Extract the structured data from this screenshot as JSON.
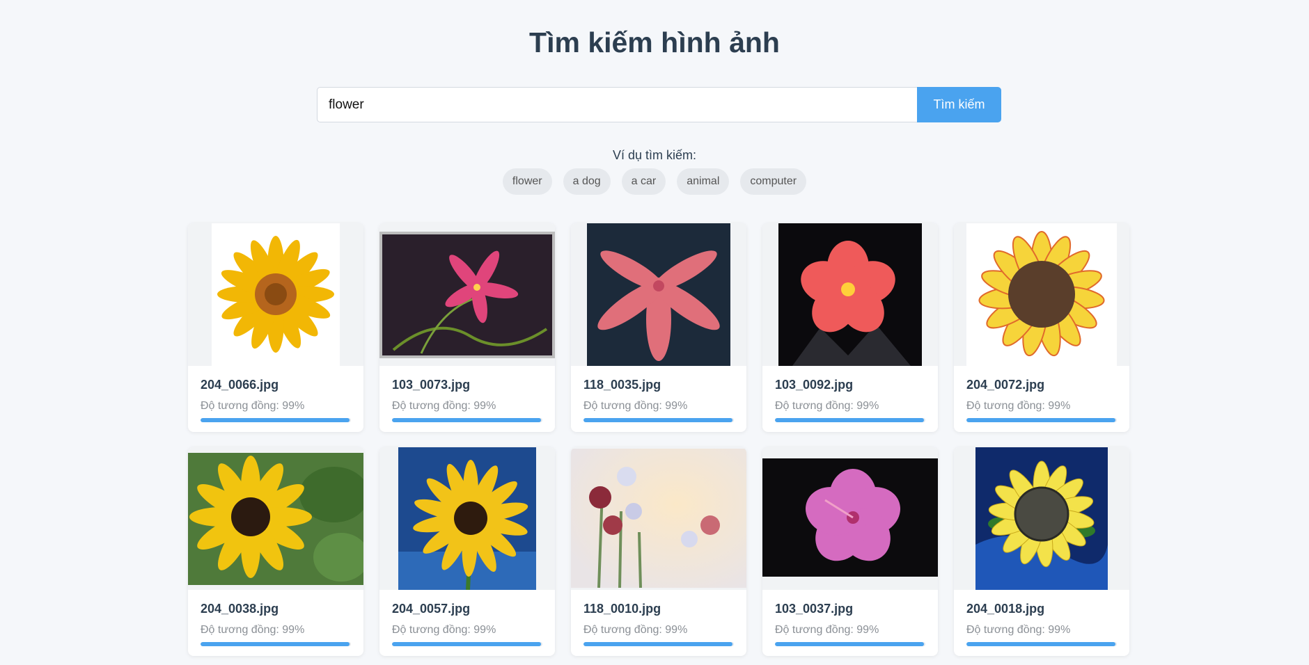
{
  "page": {
    "title": "Tìm kiếm hình ảnh"
  },
  "search": {
    "value": "flower",
    "button_label": "Tìm kiếm"
  },
  "examples": {
    "label": "Ví dụ tìm kiếm:",
    "chips": [
      "flower",
      "a dog",
      "a car",
      "animal",
      "computer"
    ]
  },
  "results": [
    {
      "file": "204_0066.jpg",
      "similarity_label": "Độ tương đồng: 99%",
      "similarity": 0.99
    },
    {
      "file": "103_0073.jpg",
      "similarity_label": "Độ tương đồng: 99%",
      "similarity": 0.99
    },
    {
      "file": "118_0035.jpg",
      "similarity_label": "Độ tương đồng: 99%",
      "similarity": 0.99
    },
    {
      "file": "103_0092.jpg",
      "similarity_label": "Độ tương đồng: 99%",
      "similarity": 0.99
    },
    {
      "file": "204_0072.jpg",
      "similarity_label": "Độ tương đồng: 99%",
      "similarity": 0.99
    },
    {
      "file": "204_0038.jpg",
      "similarity_label": "Độ tương đồng: 99%",
      "similarity": 0.99
    },
    {
      "file": "204_0057.jpg",
      "similarity_label": "Độ tương đồng: 99%",
      "similarity": 0.99
    },
    {
      "file": "118_0010.jpg",
      "similarity_label": "Độ tương đồng: 99%",
      "similarity": 0.99
    },
    {
      "file": "103_0037.jpg",
      "similarity_label": "Độ tương đồng: 99%",
      "similarity": 0.99
    },
    {
      "file": "204_0018.jpg",
      "similarity_label": "Độ tương đồng: 99%",
      "similarity": 0.99
    }
  ],
  "colors": {
    "accent": "#4aa3ef",
    "background": "#f5f7fa",
    "text": "#2c3e50"
  }
}
